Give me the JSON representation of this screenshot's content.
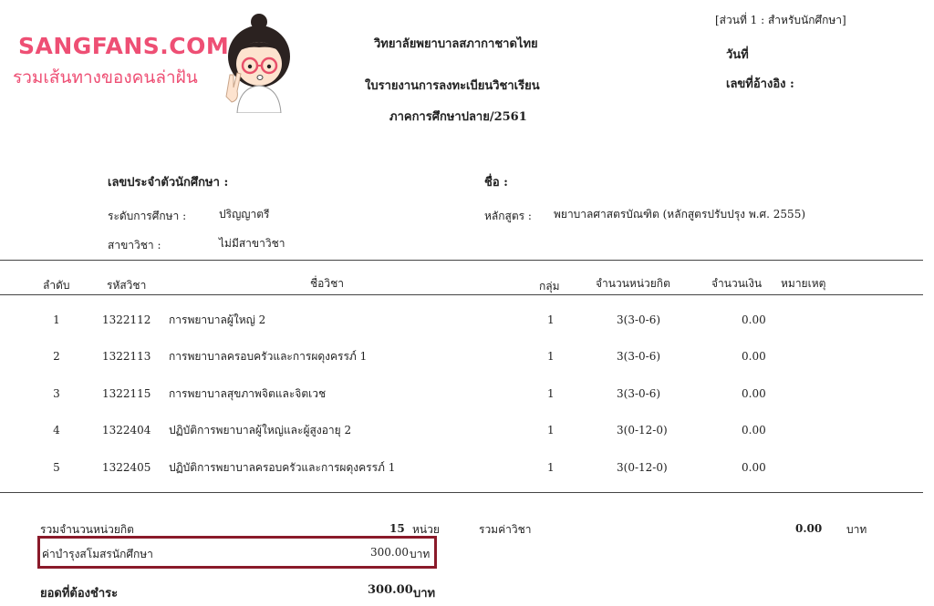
{
  "logo": {
    "title": "SANGFANS.COM",
    "tagline": "รวมเส้นทางของคนล่าฝัน"
  },
  "header": {
    "section_label": "[ส่วนที่ 1 : สำหรับนักศึกษา]",
    "college_name": "วิทยาลัยพยาบาลสภากาชาดไทย",
    "date_label": "วันที่",
    "doc_title": "ใบรายงานการลงทะเบียนวิชาเรียน",
    "reference_label": "เลขที่อ้างอิง  :",
    "semester": "ภาคการศึกษาปลาย/2561"
  },
  "student": {
    "id_label": "เลขประจำตัวนักศึกษา :",
    "name_label": "ชื่อ :",
    "level_label": "ระดับการศึกษา :",
    "level_value": "ปริญญาตรี",
    "curriculum_label": "หลักสูตร :",
    "curriculum_value": "พยาบาลศาสตรบัณฑิต (หลักสูตรปรับปรุง พ.ศ. 2555)",
    "major_label": "สาขาวิชา :",
    "major_value": "ไม่มีสาขาวิชา"
  },
  "table": {
    "headers": {
      "no": "ลำดับ",
      "code": "รหัสวิชา",
      "name": "ชื่อวิชา",
      "group": "กลุ่ม",
      "credits": "จำนวนหน่วยกิต",
      "amount": "จำนวนเงิน",
      "remark": "หมายเหตุ"
    },
    "rows": [
      {
        "no": "1",
        "code": "1322112",
        "name": "การพยาบาลผู้ใหญ่ 2",
        "group": "1",
        "credits": "3(3-0-6)",
        "amount": "0.00"
      },
      {
        "no": "2",
        "code": "1322113",
        "name": "การพยาบาลครอบครัวและการผดุงครรภ์ 1",
        "group": "1",
        "credits": "3(3-0-6)",
        "amount": "0.00"
      },
      {
        "no": "3",
        "code": "1322115",
        "name": "การพยาบาลสุขภาพจิตและจิตเวช",
        "group": "1",
        "credits": "3(3-0-6)",
        "amount": "0.00"
      },
      {
        "no": "4",
        "code": "1322404",
        "name": "ปฏิบัติการพยาบาลผู้ใหญ่และผู้สูงอายุ 2",
        "group": "1",
        "credits": "3(0-12-0)",
        "amount": "0.00"
      },
      {
        "no": "5",
        "code": "1322405",
        "name": "ปฏิบัติการพยาบาลครอบครัวและการผดุงครรภ์ 1",
        "group": "1",
        "credits": "3(0-12-0)",
        "amount": "0.00"
      }
    ]
  },
  "summary": {
    "total_credits_label": "รวมจำนวนหน่วยกิต",
    "total_credits_value": "15",
    "total_credits_unit": "หน่วย",
    "course_fee_label": "รวมค่าวิชา",
    "course_fee_value": "0.00",
    "course_fee_unit": "บาท",
    "club_fee_label": "ค่าบำรุงสโมสรนักศึกษา",
    "club_fee_value": "300.00",
    "club_fee_unit": "บาท",
    "due_label": "ยอดที่ต้องชำระ",
    "due_value": "300.00",
    "due_unit": "บาท"
  },
  "colors": {
    "logo": "#ee4f74",
    "highlight_box": "#8a1a2a"
  }
}
